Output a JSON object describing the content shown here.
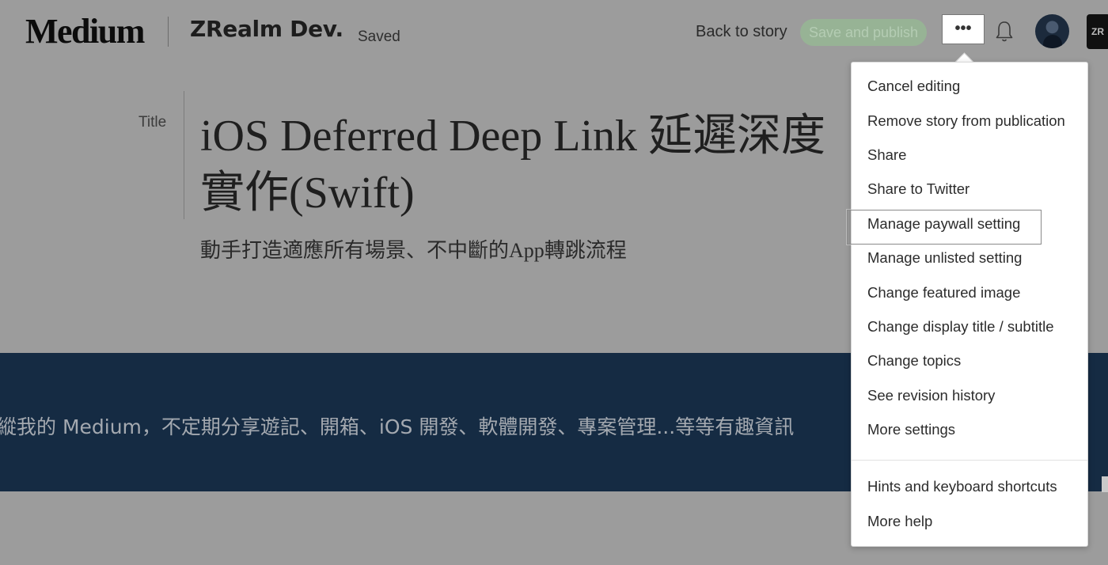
{
  "header": {
    "logo": "Medium",
    "publication": "ZRealm Dev.",
    "save_status": "Saved",
    "back_label": "Back to story",
    "publish_label": "Save and publish",
    "more_label": "•••",
    "corner_badge": "ZR"
  },
  "editor": {
    "title_label": "Title",
    "title_line1": "iOS Deferred Deep Link 延遲深度",
    "title_line2": "實作(Swift)",
    "subtitle": "動手打造適應所有場景、不中斷的App轉跳流程"
  },
  "banner": {
    "text": "縱我的 Medium，不定期分享遊記、開箱、iOS 開發、軟體開發、專案管理...等等有趣資訊"
  },
  "menu": {
    "items": [
      "Cancel editing",
      "Remove story from publication",
      "Share",
      "Share to Twitter",
      "Manage paywall setting",
      "Manage unlisted setting",
      "Change featured image",
      "Change display title / subtitle",
      "Change topics",
      "See revision history",
      "More settings"
    ],
    "help_items": [
      "Hints and keyboard shortcuts",
      "More help"
    ],
    "highlighted": "Manage paywall setting"
  },
  "icons": {
    "bell": "bell-icon",
    "avatar": "user-avatar",
    "more": "more-options-icon"
  },
  "colors": {
    "overlay": "#9c9c9c",
    "publish_green": "#97b395",
    "banner": "#152b43"
  }
}
